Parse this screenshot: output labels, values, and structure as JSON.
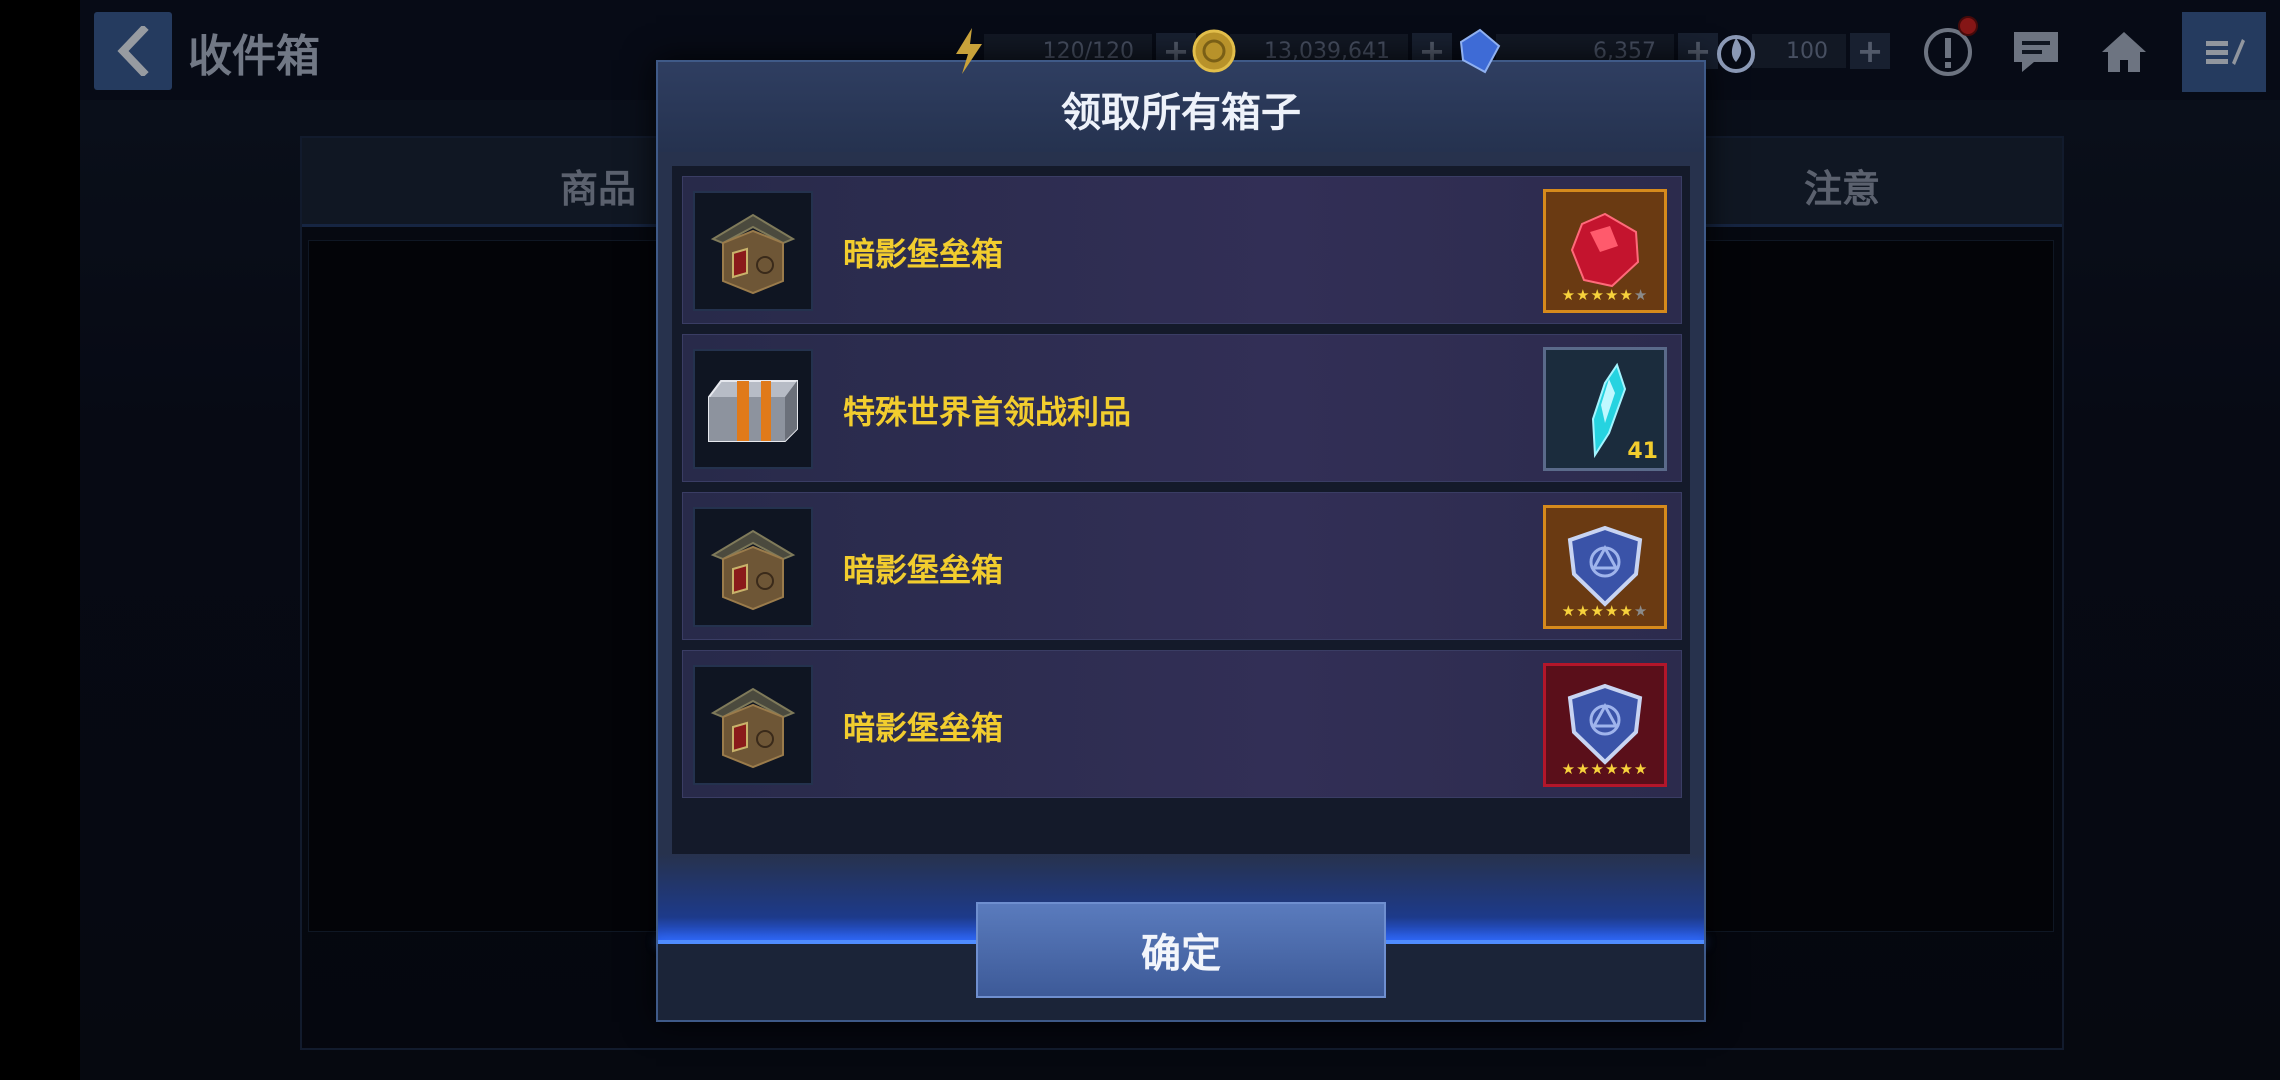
{
  "header": {
    "title": "收件箱",
    "back_icon": "chevron-left-icon"
  },
  "resources": {
    "energy": {
      "value": "120/120",
      "icon": "lightning-icon"
    },
    "gold": {
      "value": "13,039,641",
      "icon": "gold-coin-icon"
    },
    "crystal": {
      "value": "6,357",
      "icon": "blue-crystal-icon"
    },
    "stamina": {
      "value": "100",
      "icon": "flame-icon"
    },
    "plus": "+"
  },
  "top_icons": [
    "alert-icon",
    "chat-icon",
    "home-icon",
    "menu-icon"
  ],
  "background_tabs": {
    "left": "商品",
    "right": "注意"
  },
  "modal": {
    "title": "领取所有箱子",
    "items": [
      {
        "name": "暗影堡垒箱",
        "box_icon": "pagoda-box-icon",
        "reward_icon": "red-gem-icon",
        "reward_frame": "orange",
        "stars": "★★★★★",
        "stars_dim": "★",
        "count": ""
      },
      {
        "name": "特殊世界首领战利品",
        "box_icon": "silver-chest-icon",
        "reward_icon": "cyan-crystal-icon",
        "reward_frame": "blue",
        "stars": "",
        "stars_dim": "",
        "count": "41"
      },
      {
        "name": "暗影堡垒箱",
        "box_icon": "pagoda-box-icon",
        "reward_icon": "shield-emblem-icon",
        "reward_frame": "orange",
        "stars": "★★★★★",
        "stars_dim": "★",
        "count": ""
      },
      {
        "name": "暗影堡垒箱",
        "box_icon": "pagoda-box-icon",
        "reward_icon": "shield-emblem-icon",
        "reward_frame": "red",
        "stars": "★★★★★★",
        "stars_dim": "",
        "count": ""
      }
    ],
    "confirm_label": "确定"
  },
  "colors": {
    "accent_blue": "#3a5b92",
    "item_name": "#f2cd2e",
    "frame_orange": "#d68a1c",
    "frame_red": "#b3162a"
  }
}
